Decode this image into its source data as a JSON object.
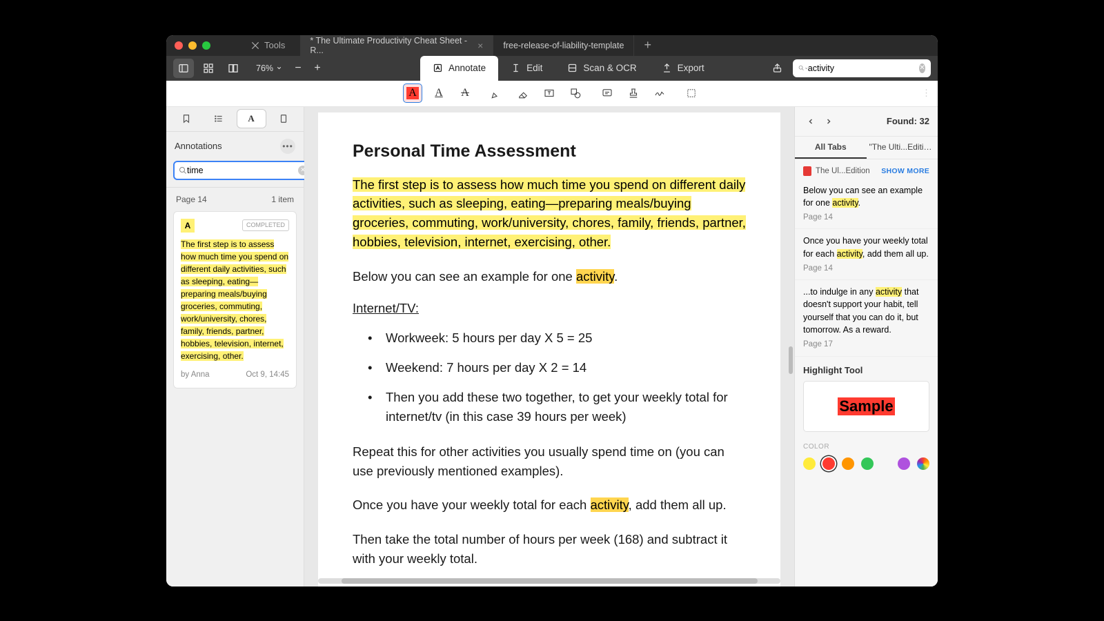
{
  "titlebar": {
    "tools_label": "Tools",
    "tabs": [
      {
        "label": "* The Ultimate Productivity Cheat Sheet - R..."
      },
      {
        "label": "free-release-of-liability-template"
      }
    ]
  },
  "toolbar": {
    "zoom": "76%",
    "modes": {
      "annotate": "Annotate",
      "edit": "Edit",
      "scan": "Scan & OCR",
      "export": "Export"
    },
    "search_value": "activity"
  },
  "left": {
    "panel_title": "Annotations",
    "search_value": "time",
    "section": {
      "page": "Page 14",
      "count": "1 item"
    },
    "card": {
      "badge": "COMPLETED",
      "text_pre": "The first step is to assess how much ",
      "text_hit": "time",
      "text_post": " you spend on different daily activities, such as sleeping, eating—preparing meals/buying groceries, commuting, work/university, chores, family, friends, partner, hobbies, television, internet, exercising, other.",
      "author": "by Anna",
      "date": "Oct 9, 14:45"
    }
  },
  "doc": {
    "title": "Personal Time Assessment",
    "p1": "The first step is to assess how much time you spend on different daily activities, such as sleeping, eating—preparing meals/buying groceries, commuting, work/university, chores, family, friends, partner, hobbies, television, internet, exercising, other.",
    "p2_pre": "Below you can see an example for one ",
    "p2_hit": "activity",
    "p2_post": ".",
    "h2": "Internet/TV:",
    "bullets": [
      "Workweek: 5 hours per day X 5 = 25",
      "Weekend: 7 hours per day X 2 = 14",
      "Then you add these two together, to get your weekly total for internet/tv (in this case 39 hours per week)"
    ],
    "p3": "Repeat this for other activities you usually spend time on (you can use previously mentioned examples).",
    "p4_pre": "Once you have your weekly total for each ",
    "p4_hit": "activity",
    "p4_post": ", add them all up.",
    "p5": "Then take the total number of hours per week (168) and subtract it with your weekly total."
  },
  "right": {
    "found": "Found: 32",
    "scope": {
      "all": "All Tabs",
      "doc": "\"The Ulti...Edition\""
    },
    "doc_chip": {
      "name": "The Ul...Edition",
      "more": "SHOW MORE"
    },
    "results": [
      {
        "pre": "Below you can see an example for one ",
        "hit": "activity",
        "post": ".",
        "page": "Page 14"
      },
      {
        "pre": "Once you have your weekly total for each ",
        "hit": "activity",
        "post": ", add them all up.",
        "page": "Page 14"
      },
      {
        "pre": "...to indulge in any ",
        "hit": "activity",
        "post": " that doesn't support your habit, tell yourself that you can do it, but tomorrow. As a reward.",
        "page": "Page 17"
      }
    ],
    "tool_title": "Highlight Tool",
    "sample": "Sample",
    "color_label": "COLOR",
    "colors": [
      "#ffeb3b",
      "#ff3b30",
      "#ff9500",
      "#34c759",
      "#af52de"
    ]
  }
}
